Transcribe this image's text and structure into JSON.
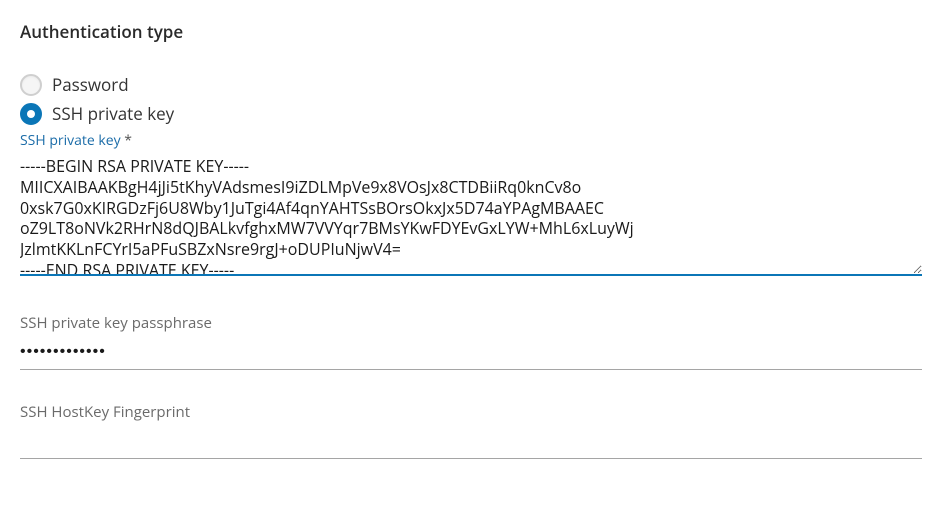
{
  "section": {
    "title": "Authentication type"
  },
  "auth_type": {
    "options": [
      {
        "label": "Password",
        "selected": false
      },
      {
        "label": "SSH private key",
        "selected": true
      }
    ]
  },
  "ssh_key": {
    "label": "SSH private key",
    "required_marker": "*",
    "value": "-----BEGIN RSA PRIVATE KEY-----\nMIICXAIBAAKBgH4jJi5tKhyVAdsmesI9iZDLMpVe9x8VOsJx8CTDBiiRq0knCv8o\n0xsk7G0xKIRGDzFj6U8Wby1JuTgi4Af4qnYAHTSsBOrsOkxJx5D74aYPAgMBAAEC\noZ9LT8oNVk2RHrN8dQJBALkvfghxMW7VVYqr7BMsYKwFDYEvGxLYW+MhL6xLuyWj\nJzlmtKKLnFCYrI5aPFuSBZxNsre9rgJ+oDUPIuNjwV4=\n-----END RSA PRIVATE KEY-----"
  },
  "passphrase": {
    "label": "SSH private key passphrase",
    "value": "•••••••••••••"
  },
  "hostkey": {
    "label": "SSH HostKey Fingerprint",
    "value": ""
  }
}
